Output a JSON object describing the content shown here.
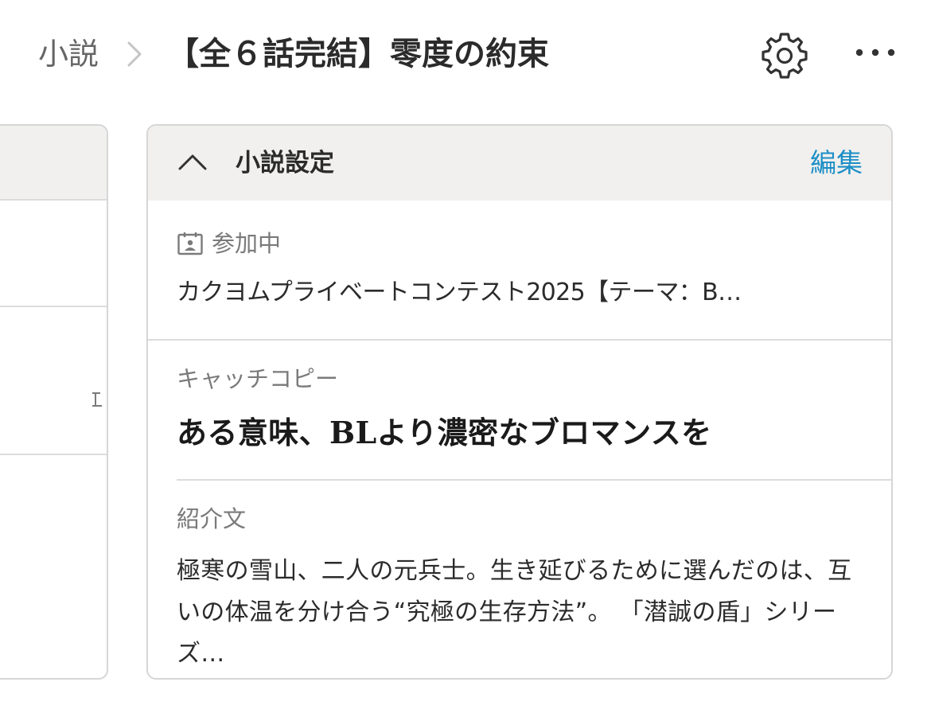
{
  "header": {
    "breadcrumb_parent": "小説",
    "title": "【全６話完結】零度の約束",
    "icons": {
      "separator": "chevron-right-icon",
      "settings": "gear-icon",
      "more": "more-horizontal-icon"
    }
  },
  "settings_card": {
    "title": "小説設定",
    "edit_label": "編集",
    "collapse_icon": "chevron-up-icon",
    "participation": {
      "icon": "contest-calendar-icon",
      "label": "参加中",
      "contest_name": "カクヨムプライベートコンテスト2025【テーマ：B…"
    },
    "catchcopy": {
      "label": "キャッチコピー",
      "text": "ある意味、BLより濃密なブロマンスを"
    },
    "introduction": {
      "label": "紹介文",
      "text": "極寒の雪山、二人の元兵士。生き延びるために選んだのは、互いの体温を分け合う“究極の生存方法”。 「潜誠の盾」シリーズ…"
    }
  },
  "colors": {
    "accent_link": "#1b8ec6",
    "header_bg": "#f1f0ee",
    "border": "#d6d6d6",
    "text_primary": "#2b2b2b",
    "text_secondary": "#7a7a7a"
  }
}
